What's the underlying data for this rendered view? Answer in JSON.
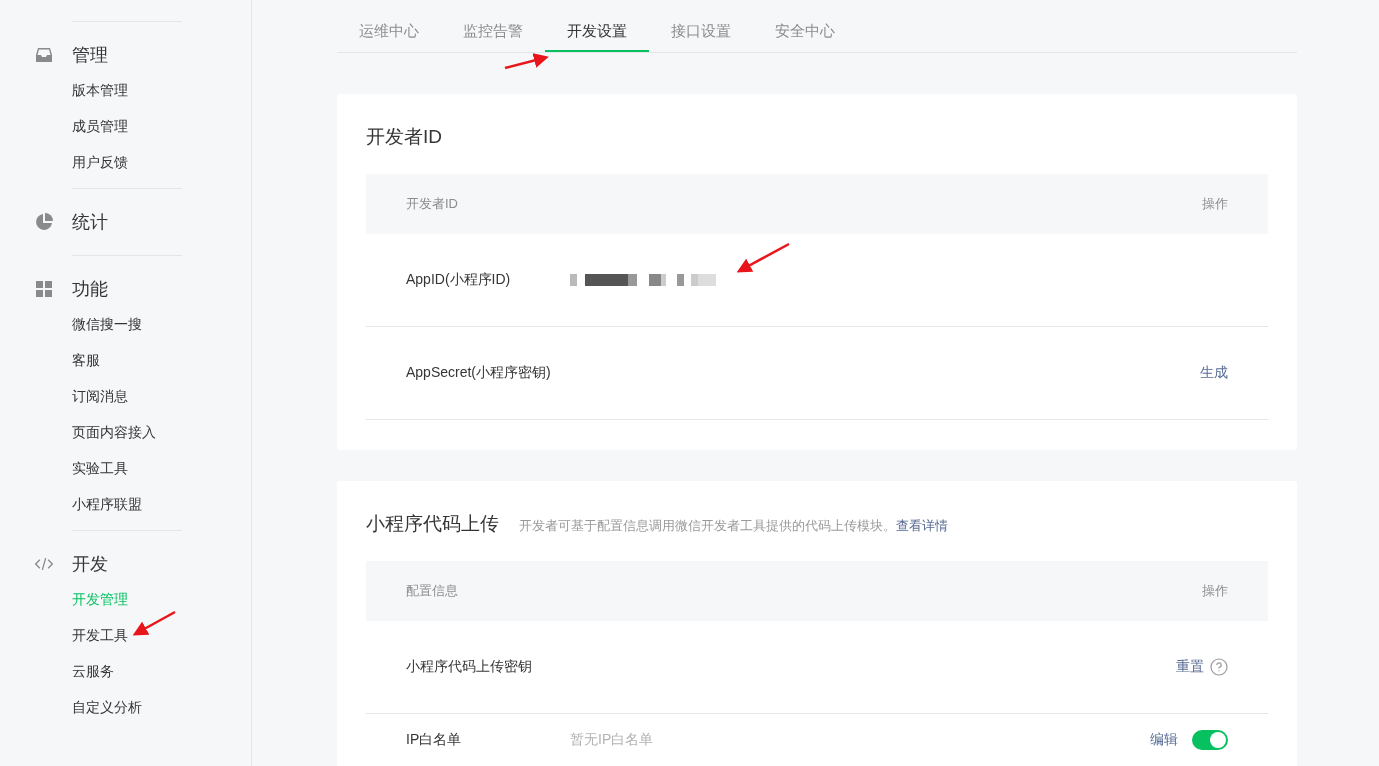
{
  "sidebar": {
    "groups": [
      {
        "title": "管理",
        "items": [
          {
            "label": "版本管理",
            "selected": false
          },
          {
            "label": "成员管理",
            "selected": false
          },
          {
            "label": "用户反馈",
            "selected": false
          }
        ]
      },
      {
        "title": "统计"
      },
      {
        "title": "功能",
        "items": [
          {
            "label": "微信搜一搜",
            "selected": false
          },
          {
            "label": "客服",
            "selected": false
          },
          {
            "label": "订阅消息",
            "selected": false
          },
          {
            "label": "页面内容接入",
            "selected": false
          },
          {
            "label": "实验工具",
            "selected": false
          },
          {
            "label": "小程序联盟",
            "selected": false
          }
        ]
      },
      {
        "title": "开发",
        "items": [
          {
            "label": "开发管理",
            "selected": true
          },
          {
            "label": "开发工具",
            "selected": false
          },
          {
            "label": "云服务",
            "selected": false
          },
          {
            "label": "自定义分析",
            "selected": false
          }
        ]
      }
    ]
  },
  "tabs": [
    {
      "label": "运维中心",
      "selected": false
    },
    {
      "label": "监控告警",
      "selected": false
    },
    {
      "label": "开发设置",
      "selected": true
    },
    {
      "label": "接口设置",
      "selected": false
    },
    {
      "label": "安全中心",
      "selected": false
    }
  ],
  "cards": [
    {
      "title": "开发者ID",
      "columns": [
        "开发者ID",
        "操作"
      ],
      "rows": [
        {
          "label": "AppID(小程序ID)",
          "redacted": true
        },
        {
          "label": "AppSecret(小程序密钥)",
          "action": "生成"
        }
      ]
    },
    {
      "title": "小程序代码上传",
      "description": "开发者可基于配置信息调用微信开发者工具提供的代码上传模块。",
      "link": "查看详情",
      "columns": [
        "配置信息",
        "操作"
      ],
      "rows": [
        {
          "label": "小程序代码上传密钥",
          "action": "重置",
          "help": true
        },
        {
          "label": "IP白名单",
          "value": "暂无IP白名单",
          "action": "编辑",
          "toggle": {
            "on": true
          }
        }
      ]
    }
  ]
}
